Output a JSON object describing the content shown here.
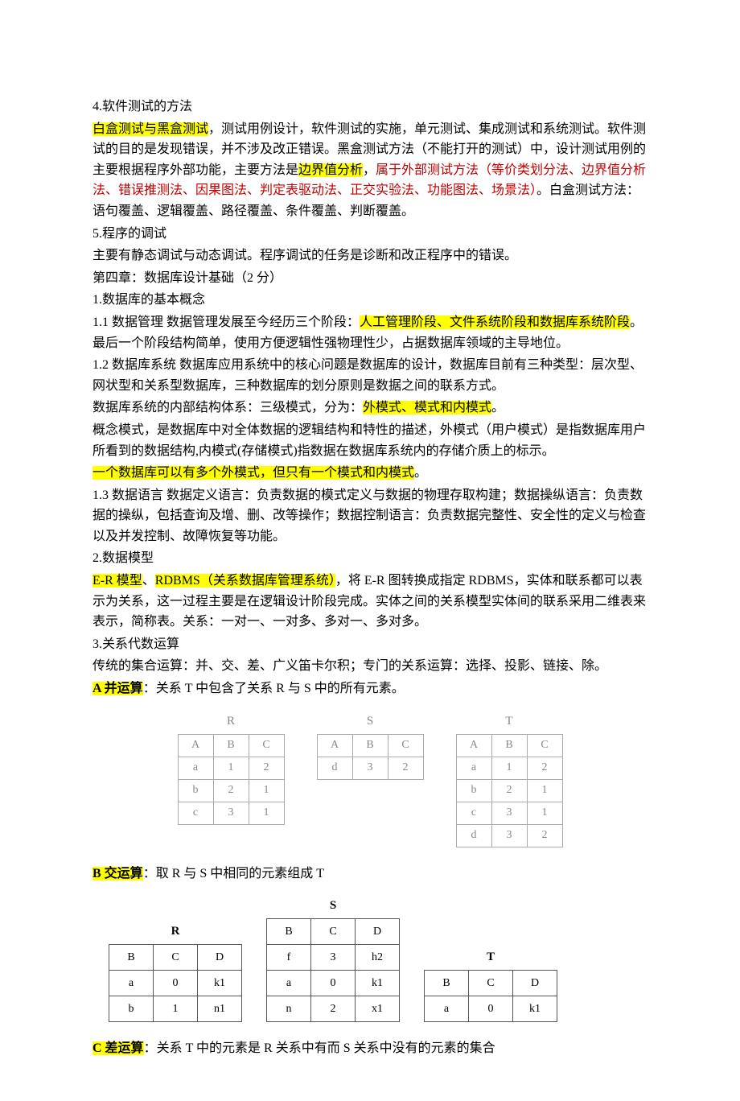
{
  "p1": "4.软件测试的方法",
  "p2a": "白盒测试与黑盒测试",
  "p2b": "，测试用例设计，软件测试的实施，单元测试、集成测试和系统测试。软件测试的目的是发现错误，并不涉及改正错误。黑盒测试方法（不能打开的测试）中，设计测试用例的主要根据程序外部功能，主要方法是",
  "p2c": "边界值分析",
  "p2d": "，",
  "p2e": "属于外部测试方法（等价类划分法、边界值分析法、错误推测法、因果图法、判定表驱动法、正交实验法、功能图法、场景法）",
  "p2f": "。白盒测试方法：语句覆盖、逻辑覆盖、路径覆盖、条件覆盖、判断覆盖。",
  "p3": "5.程序的调试",
  "p4": "主要有静态调试与动态调试。程序调试的任务是诊断和改正程序中的错误。",
  "p5": "第四章：数据库设计基础（2 分）",
  "p6": "1.数据库的基本概念",
  "p7a": "1.1 数据管理  数据管理发展至今经历三个阶段：",
  "p7b": "人工管理阶段、文件系统阶段和数据库系统阶段",
  "p7c": "。最后一个阶段结构简单，使用方便逻辑性强物理性少，占据数据库领域的主导地位。",
  "p8": "1.2 数据库系统  数据库应用系统中的核心问题是数据库的设计，数据库目前有三种类型：层次型、网状型和关系型数据库，三种数据库的划分原则是数据之间的联系方式。",
  "p9a": "数据库系统的内部结构体系：三级模式，分为：",
  "p9b": "外模式、模式和内模式",
  "p9c": "。",
  "p10": "概念模式，是数据库中对全体数据的逻辑结构和特性的描述，外模式（用户模式）是指数据库用户所看到的数据结构,内模式(存储模式)指数据在数据库系统内的存储介质上的标示。",
  "p11": "一个数据库可以有多个外模式，但只有一个模式和内模式",
  "p11b": "。",
  "p12": "1.3 数据语言  数据定义语言：负责数据的模式定义与数据的物理存取构建；数据操纵语言：负责数据的操纵，包括查询及增、删、改等操作；数据控制语言：负责数据完整性、安全性的定义与检查以及并发控制、故障恢复等功能。",
  "p13": "2.数据模型",
  "p14a": "E-R 模型",
  "p14b": "、",
  "p14c": "RDBMS（关系数据库管理系统）",
  "p14d": "，将 E-R 图转换成指定 RDBMS，实体和联系都可以表示为关系，这一过程主要是在逻辑设计阶段完成。实体之间的关系模型实体间的联系采用二维表来表示，简称表。关系：一对一、一对多、多对一、多对多。",
  "p15": "3.关系代数运算",
  "p16": "传统的集合运算：并、交、差、广义笛卡尔积；专门的关系运算：选择、投影、链接、除。",
  "p17a": "A 并运算",
  "p17b": "：关系 T 中包含了关系 R 与 S 中的所有元素。",
  "tables_union": {
    "R": {
      "header": [
        "A",
        "B",
        "C"
      ],
      "rows": [
        [
          "a",
          "1",
          "2"
        ],
        [
          "b",
          "2",
          "1"
        ],
        [
          "c",
          "3",
          "1"
        ]
      ]
    },
    "S": {
      "header": [
        "A",
        "B",
        "C"
      ],
      "rows": [
        [
          "d",
          "3",
          "2"
        ]
      ]
    },
    "T": {
      "header": [
        "A",
        "B",
        "C"
      ],
      "rows": [
        [
          "a",
          "1",
          "2"
        ],
        [
          "b",
          "2",
          "1"
        ],
        [
          "c",
          "3",
          "1"
        ],
        [
          "d",
          "3",
          "2"
        ]
      ]
    }
  },
  "p18a": "B 交运算",
  "p18b": "：取 R 与 S 中相同的元素组成 T",
  "tables_inter": {
    "R": {
      "header": [
        "B",
        "C",
        "D"
      ],
      "rows": [
        [
          "a",
          "0",
          "k1"
        ],
        [
          "b",
          "1",
          "n1"
        ]
      ]
    },
    "S": {
      "header": [
        "B",
        "C",
        "D"
      ],
      "rows": [
        [
          "f",
          "3",
          "h2"
        ],
        [
          "a",
          "0",
          "k1"
        ],
        [
          "n",
          "2",
          "x1"
        ]
      ]
    },
    "T": {
      "header": [
        "B",
        "C",
        "D"
      ],
      "rows": [
        [
          "a",
          "0",
          "k1"
        ]
      ]
    }
  },
  "p19a": "C 差运算",
  "p19b": "：关系 T 中的元素是 R 关系中有而 S 关系中没有的元素的集合",
  "captions": {
    "R": "R",
    "S": "S",
    "T": "T"
  }
}
